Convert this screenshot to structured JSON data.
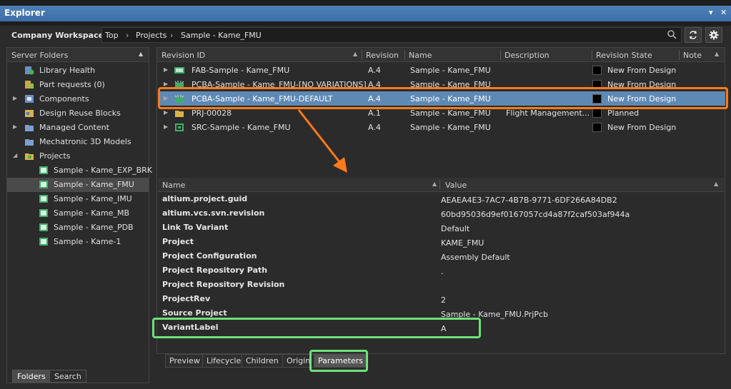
{
  "window": {
    "title": "Explorer",
    "pin": "▾",
    "close": "✕"
  },
  "toolbar": {
    "workspace": "Company Workspace ▾",
    "breadcrumb": [
      "Top",
      "Projects",
      "Sample - Kame_FMU"
    ],
    "breadcrumb_sep": "›",
    "refresh_icon": "refresh-icon",
    "settings_icon": "gear-icon"
  },
  "folders": {
    "header": "Server Folders",
    "items": [
      {
        "label": "Library Health",
        "icon": "library-health-icon",
        "expandable": false,
        "indent": 0
      },
      {
        "label": "Part requests (0)",
        "icon": "part-requests-icon",
        "expandable": false,
        "indent": 0
      },
      {
        "label": "Components",
        "icon": "components-icon",
        "expandable": true,
        "indent": 0
      },
      {
        "label": "Design Reuse Blocks",
        "icon": "design-reuse-icon",
        "expandable": false,
        "indent": 0
      },
      {
        "label": "Managed Content",
        "icon": "folder-icon",
        "expandable": true,
        "indent": 0
      },
      {
        "label": "Mechatronic 3D Models",
        "icon": "folder-icon",
        "expandable": false,
        "indent": 0
      },
      {
        "label": "Projects",
        "icon": "projects-icon",
        "expandable": true,
        "indent": 0
      },
      {
        "label": "Sample - Kame_EXP_BRK",
        "icon": "project-icon",
        "expandable": false,
        "indent": 1
      },
      {
        "label": "Sample - Kame_FMU",
        "icon": "project-icon",
        "expandable": false,
        "indent": 1,
        "selected": true
      },
      {
        "label": "Sample - Kame_IMU",
        "icon": "project-icon",
        "expandable": false,
        "indent": 1
      },
      {
        "label": "Sample - Kame_MB",
        "icon": "project-icon",
        "expandable": false,
        "indent": 1
      },
      {
        "label": "Sample - Kame_PDB",
        "icon": "project-icon",
        "expandable": false,
        "indent": 1
      },
      {
        "label": "Sample - Kame-1",
        "icon": "project-icon",
        "expandable": false,
        "indent": 1
      }
    ],
    "tabs": [
      "Folders",
      "Search"
    ]
  },
  "grid": {
    "columns": [
      "Revision ID",
      "Revision",
      "Name",
      "Description",
      "Revision State",
      "Note"
    ],
    "rows": [
      {
        "id": "FAB-Sample - Kame_FMU",
        "rev": "A.4",
        "name": "Sample - Kame_FMU",
        "desc": "",
        "state": "New From Design",
        "icon": "fab-icon"
      },
      {
        "id": "PCBA-Sample - Kame_FMU-[NO VARIATIONS]",
        "rev": "A.4",
        "name": "Sample - Kame_FMU",
        "desc": "",
        "state": "New From Design",
        "icon": "pcba-icon"
      },
      {
        "id": "PCBA-Sample - Kame_FMU-DEFAULT",
        "rev": "A.4",
        "name": "Sample - Kame_FMU",
        "desc": "",
        "state": "New From Design",
        "icon": "pcba-icon",
        "selected": true
      },
      {
        "id": "PRJ-00028",
        "rev": "A.1",
        "name": "Sample - Kame_FMU",
        "desc": "Flight Management...",
        "state": "Planned",
        "icon": "prj-icon"
      },
      {
        "id": "SRC-Sample - Kame_FMU",
        "rev": "A.4",
        "name": "Sample - Kame_FMU",
        "desc": "",
        "state": "New From Design",
        "icon": "src-icon"
      }
    ]
  },
  "params": {
    "columns": [
      "Name",
      "Value"
    ],
    "rows": [
      {
        "k": "altium.project.guid",
        "v": "AEAEA4E3-7AC7-4B7B-9771-6DF266A84DB2"
      },
      {
        "k": "altium.vcs.svn.revision",
        "v": "60bd95036d9ef0167057cd4a87f2caf503af944a"
      },
      {
        "k": "Link To Variant",
        "v": "Default"
      },
      {
        "k": "Project",
        "v": "KAME_FMU"
      },
      {
        "k": "Project Configuration",
        "v": "Assembly Default"
      },
      {
        "k": "Project Repository Path",
        "v": "."
      },
      {
        "k": "Project Repository Revision",
        "v": ""
      },
      {
        "k": "ProjectRev",
        "v": "2"
      },
      {
        "k": "Source Project",
        "v": "Sample - Kame_FMU.PrjPcb"
      },
      {
        "k": "VariantLabel",
        "v": "A"
      }
    ],
    "tabs": [
      "Preview",
      "Lifecycle",
      "Children",
      "Origin",
      "Parameters"
    ],
    "active_tab": "Parameters"
  },
  "colors": {
    "accent_selection": "#5e89b4",
    "highlight_orange": "#ff7a1a",
    "highlight_green": "#6de27a"
  }
}
